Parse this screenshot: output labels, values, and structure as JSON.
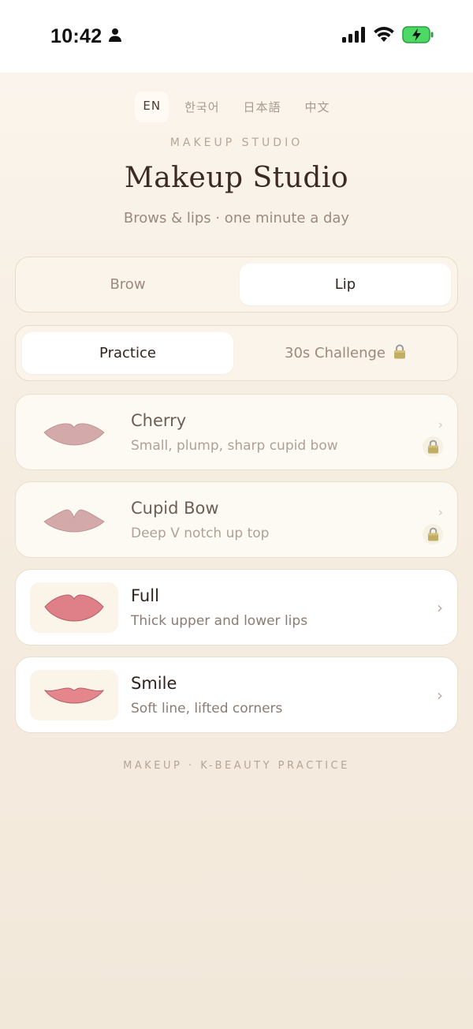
{
  "status_bar": {
    "time": "10:42",
    "icons": [
      "person-icon",
      "cellular-icon",
      "wifi-icon",
      "battery-charging-icon"
    ]
  },
  "languages": [
    {
      "label": "EN",
      "active": true
    },
    {
      "label": "한국어",
      "active": false
    },
    {
      "label": "日本語",
      "active": false
    },
    {
      "label": "中文",
      "active": false
    }
  ],
  "header": {
    "eyebrow": "MAKEUP STUDIO",
    "title": "Makeup Studio",
    "subtitle": "Brows & lips · one minute a day"
  },
  "category_tabs": [
    {
      "label": "Brow",
      "active": false
    },
    {
      "label": "Lip",
      "active": true
    }
  ],
  "mode_tabs": [
    {
      "label": "Practice",
      "active": true
    },
    {
      "label": "30s Challenge",
      "active": false,
      "icon": "lock-icon"
    }
  ],
  "lip_styles": [
    {
      "title": "Cherry",
      "subtitle": "Small, plump, sharp cupid bow",
      "locked": true,
      "color": "#d3a9a9"
    },
    {
      "title": "Cupid Bow",
      "subtitle": "Deep V notch up top",
      "locked": true,
      "color": "#d3a9a9"
    },
    {
      "title": "Full",
      "subtitle": "Thick upper and lower lips",
      "locked": false,
      "color": "#df8088"
    },
    {
      "title": "Smile",
      "subtitle": "Soft line, lifted corners",
      "locked": false,
      "color": "#e4868c"
    }
  ],
  "footer": "MAKEUP · K-BEAUTY PRACTICE",
  "colors": {
    "accent_dark": "#3b2b24",
    "lock": "#b8a55f",
    "background": "#f6ede1"
  }
}
